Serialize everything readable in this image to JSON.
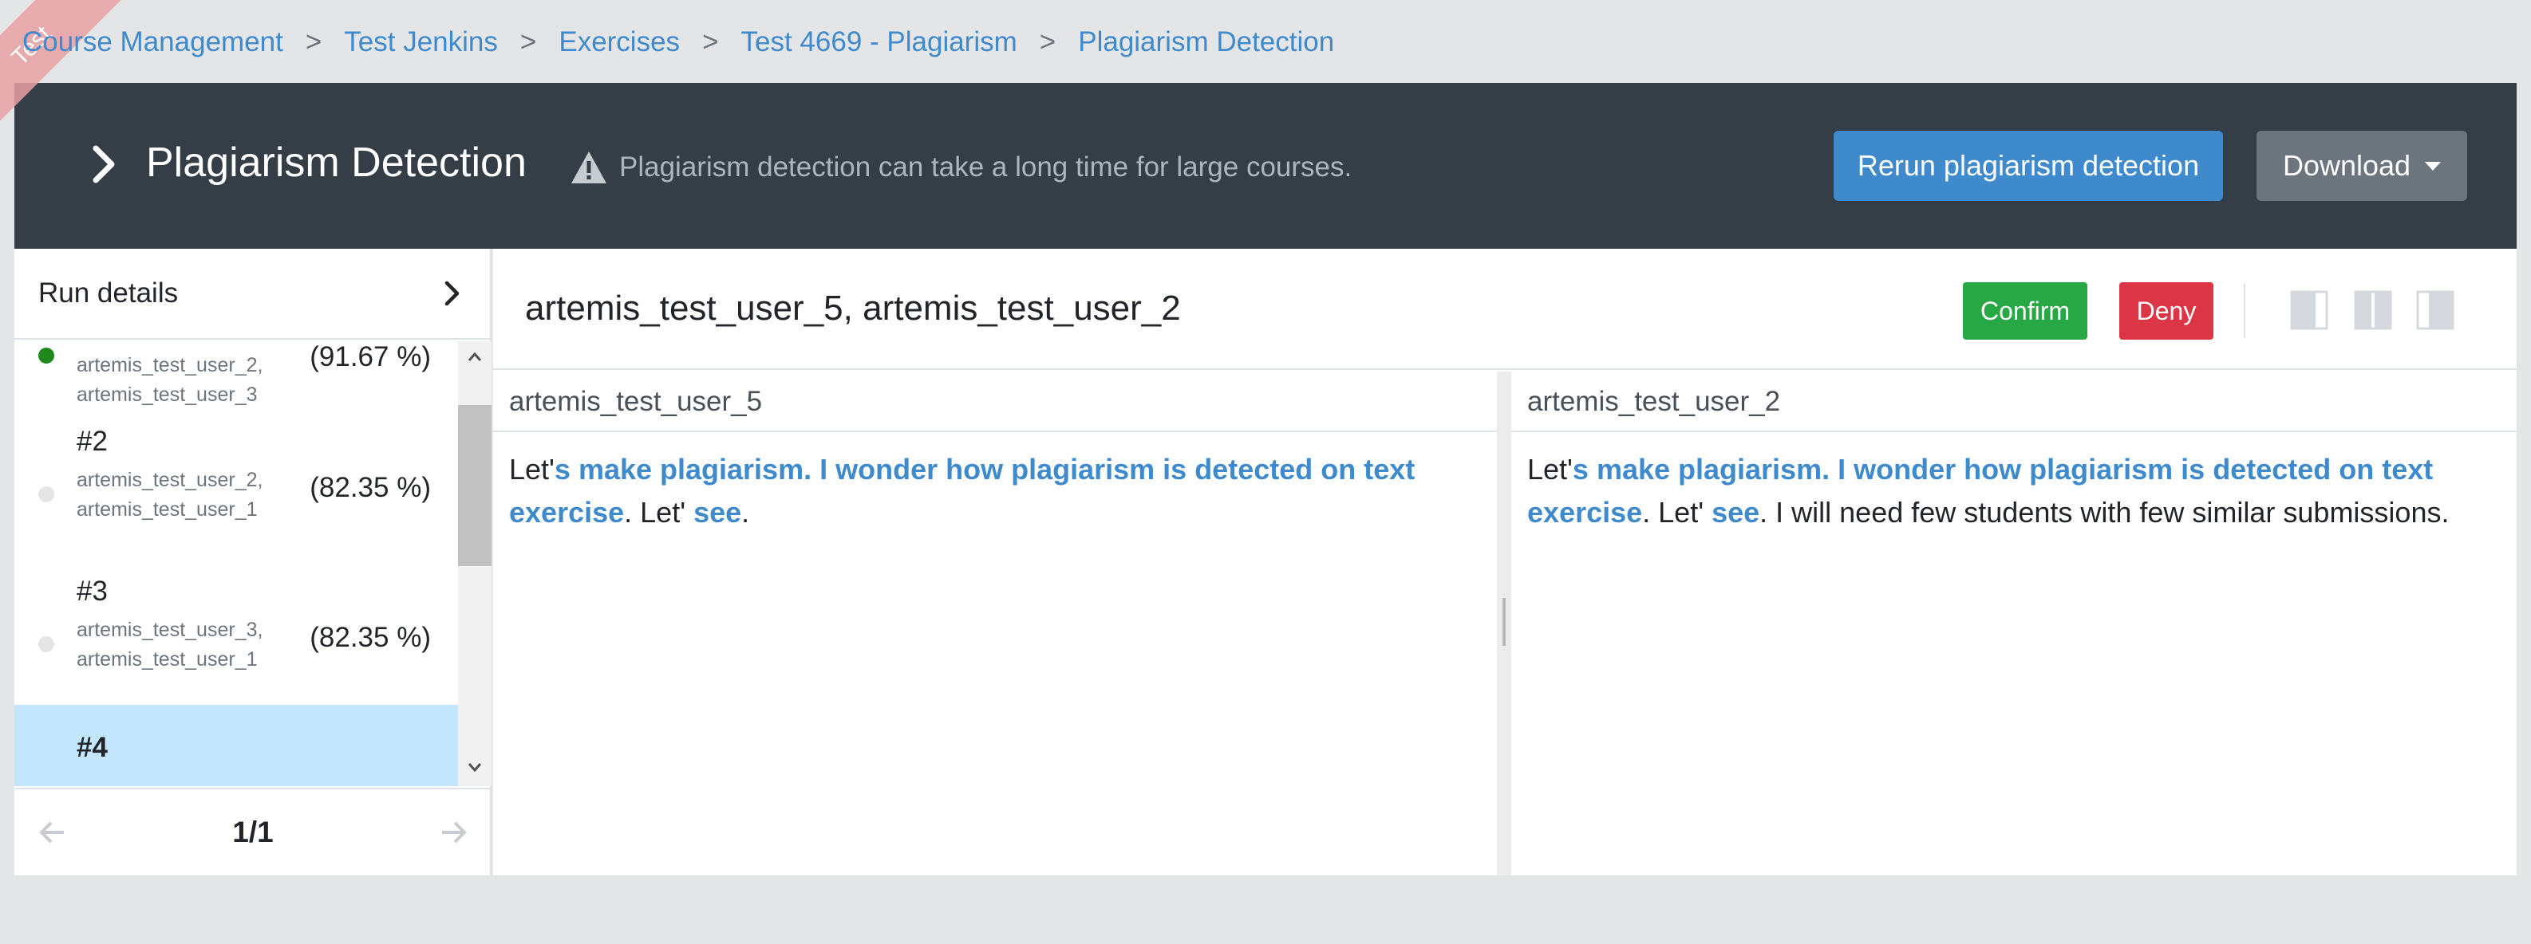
{
  "ribbon": {
    "text": "Test"
  },
  "breadcrumb": {
    "items": [
      "Course Management",
      "Test Jenkins",
      "Exercises",
      "Test 4669 - Plagiarism",
      "Plagiarism Detection"
    ],
    "separator": ">"
  },
  "header": {
    "title": "Plagiarism Detection",
    "warning": "Plagiarism detection can take a long time for large courses.",
    "rerun_label": "Rerun plagiarism detection",
    "download_label": "Download"
  },
  "sidebar": {
    "run_details_label": "Run details",
    "items": [
      {
        "number": "",
        "users": [
          "artemis_test_user_2,",
          "artemis_test_user_3"
        ],
        "similarity": "(91.67 %)",
        "status": "confirmed"
      },
      {
        "number": "#2",
        "users": [
          "artemis_test_user_2,",
          "artemis_test_user_1"
        ],
        "similarity": "(82.35 %)",
        "status": "none"
      },
      {
        "number": "#3",
        "users": [
          "artemis_test_user_3,",
          "artemis_test_user_1"
        ],
        "similarity": "(82.35 %)",
        "status": "none"
      },
      {
        "number": "#4",
        "users": [],
        "similarity": "",
        "status": "selected"
      }
    ],
    "pager": {
      "page": "1/1"
    }
  },
  "comparison": {
    "title": "artemis_test_user_5, artemis_test_user_2",
    "confirm_label": "Confirm",
    "deny_label": "Deny",
    "left": {
      "user": "artemis_test_user_5",
      "segments": [
        {
          "text": "Let'",
          "match": false
        },
        {
          "text": "s make plagiarism. I wonder how plagiarism is detected on text exercise",
          "match": true
        },
        {
          "text": ". Let' ",
          "match": false
        },
        {
          "text": "see",
          "match": true
        },
        {
          "text": ".",
          "match": false
        }
      ]
    },
    "right": {
      "user": "artemis_test_user_2",
      "segments": [
        {
          "text": "Let'",
          "match": false
        },
        {
          "text": "s make plagiarism. I wonder how plagiarism is detected on text exercise",
          "match": true
        },
        {
          "text": ". Let' ",
          "match": false
        },
        {
          "text": "see",
          "match": true
        },
        {
          "text": ". I will need few students with few similar submissions.",
          "match": false
        }
      ]
    }
  },
  "colors": {
    "header_bg": "#353d47",
    "primary": "#3e8acc",
    "success": "#28a745",
    "danger": "#dc3545",
    "secondary": "#6c757d",
    "selected_row": "#c3e6fc",
    "confirmed_dot": "#1e8a1e"
  },
  "icons": [
    "chevron-right-icon",
    "warning-icon",
    "caret-down-icon",
    "arrow-left-icon",
    "arrow-right-icon",
    "scroll-up-icon",
    "scroll-down-icon",
    "layout-left-icon",
    "layout-split-icon",
    "layout-right-icon"
  ]
}
